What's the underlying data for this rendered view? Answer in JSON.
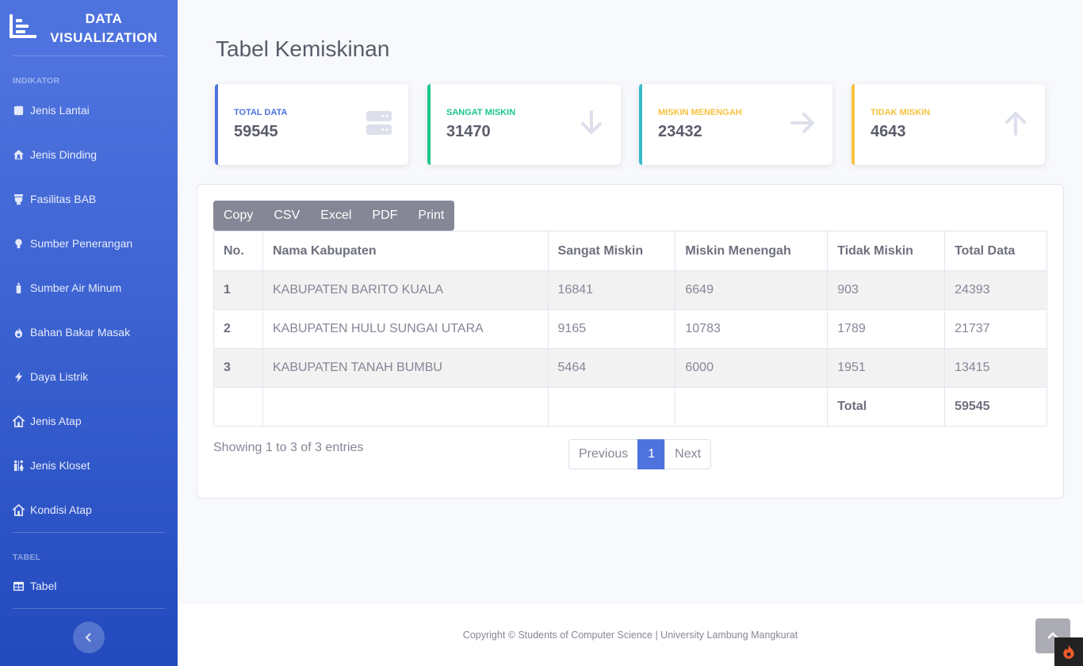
{
  "brand": {
    "line1": "DATA",
    "line2": "VISUALIZATION"
  },
  "sidebar": {
    "heading_indikator": "INDIKATOR",
    "items": [
      {
        "label": "Jenis Lantai",
        "icon": "square-icon"
      },
      {
        "label": "Jenis Dinding",
        "icon": "house-user-icon"
      },
      {
        "label": "Fasilitas BAB",
        "icon": "toilet-icon"
      },
      {
        "label": "Sumber Penerangan",
        "icon": "lightbulb-icon"
      },
      {
        "label": "Sumber Air Minum",
        "icon": "bottle-icon"
      },
      {
        "label": "Bahan Bakar Masak",
        "icon": "fire-icon"
      },
      {
        "label": "Daya Listrik",
        "icon": "bolt-icon"
      },
      {
        "label": "Jenis Atap",
        "icon": "house-icon"
      },
      {
        "label": "Jenis Kloset",
        "icon": "restroom-icon"
      },
      {
        "label": "Kondisi Atap",
        "icon": "house-icon"
      }
    ],
    "heading_tabel": "TABEL",
    "tabel_item": {
      "label": "Tabel",
      "icon": "table-icon"
    }
  },
  "page": {
    "title": "Tabel Kemiskinan"
  },
  "cards": [
    {
      "label": "TOTAL DATA",
      "value": "59545",
      "color": "#4e73df",
      "icon": "server-icon"
    },
    {
      "label": "SANGAT MISKIN",
      "value": "31470",
      "color": "#1cc88a",
      "icon": "arrow-down-icon"
    },
    {
      "label": "MISKIN MENENGAH",
      "value": "23432",
      "color": "#f6c23e",
      "stripe": "#36b9cc",
      "icon": "arrow-right-icon"
    },
    {
      "label": "TIDAK MISKIN",
      "value": "4643",
      "color": "#f6c23e",
      "icon": "arrow-up-icon"
    }
  ],
  "export_buttons": [
    "Copy",
    "CSV",
    "Excel",
    "PDF",
    "Print"
  ],
  "table": {
    "headers": [
      "No.",
      "Nama Kabupaten",
      "Sangat Miskin",
      "Miskin Menengah",
      "Tidak Miskin",
      "Total Data"
    ],
    "rows": [
      [
        "1",
        "KABUPATEN BARITO KUALA",
        "16841",
        "6649",
        "903",
        "24393"
      ],
      [
        "2",
        "KABUPATEN HULU SUNGAI UTARA",
        "9165",
        "10783",
        "1789",
        "21737"
      ],
      [
        "3",
        "KABUPATEN TANAH BUMBU",
        "5464",
        "6000",
        "1951",
        "13415"
      ]
    ],
    "footer": {
      "label": "Total",
      "value": "59545"
    }
  },
  "info": "Showing 1 to 3 of 3 entries",
  "pagination": {
    "previous": "Previous",
    "current": "1",
    "next": "Next"
  },
  "footer": {
    "text": "Copyright © Students of Computer Science | University Lambung Mangkurat"
  }
}
